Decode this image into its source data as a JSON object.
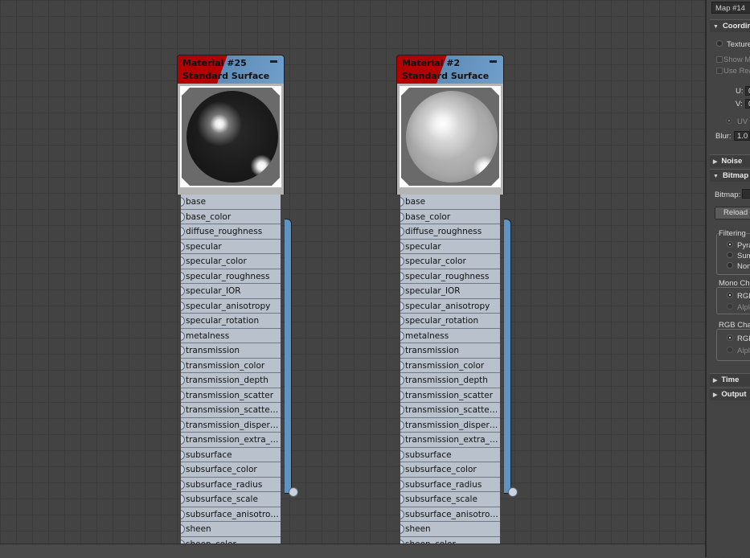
{
  "nodes": [
    {
      "title_line1": "Material #25",
      "title_line2": "Standard Surface",
      "preview": "dark"
    },
    {
      "title_line1": "Material #2",
      "title_line2": "Standard Surface",
      "preview": "light"
    }
  ],
  "slots": [
    "base",
    "base_color",
    "diffuse_roughness",
    "specular",
    "specular_color",
    "specular_roughness",
    "specular_IOR",
    "specular_anisotropy",
    "specular_rotation",
    "metalness",
    "transmission",
    "transmission_color",
    "transmission_depth",
    "transmission_scatter",
    "transmission_scatter_ani...",
    "transmission_dispersion*",
    "transmission_extra_roug...",
    "subsurface",
    "subsurface_color",
    "subsurface_radius",
    "subsurface_scale",
    "subsurface_anisotropy",
    "sheen",
    "sheen_color"
  ],
  "panel": {
    "map_name": "Map #14",
    "coordinates": "Coordin",
    "texture": "Texture",
    "show_map": "Show Ma",
    "use_real": "Use Rea",
    "u_label": "U:",
    "u_value": "0",
    "v_label": "V:",
    "v_value": "0",
    "uv": "UV",
    "blur_label": "Blur:",
    "blur_value": "1.0",
    "noise": "Noise",
    "bitmap_rollout": "Bitmap",
    "bitmap_label": "Bitmap:",
    "reload": "Reload",
    "filtering": "Filtering",
    "pyramidal": "Pyra",
    "summed": "Sum",
    "none": "Non",
    "mono_channel": "Mono Cha",
    "mono_rgb": "RGB",
    "mono_alpha": "Alpl",
    "rgb_channel": "RGB Chan",
    "rgb_rgb": "RGB",
    "rgb_alpha": "Alpl",
    "time": "Time",
    "output": "Output"
  },
  "colors": {
    "node_header_red": "#b30000",
    "node_header_blue": "#6f9fca",
    "slot_bg": "#b8c1cc",
    "canvas_bg": "#434343"
  }
}
